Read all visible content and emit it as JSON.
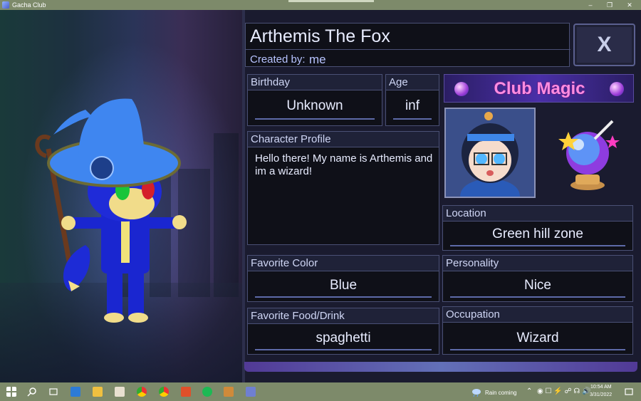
{
  "window": {
    "title": "Gacha Club"
  },
  "panel": {
    "character_name": "Arthemis The Fox",
    "created_by_label": "Created by:",
    "created_by_value": "me",
    "close_label": "X",
    "banner_text": "Club Magic",
    "birthday": {
      "label": "Birthday",
      "value": "Unknown"
    },
    "age": {
      "label": "Age",
      "value": "inf"
    },
    "profile": {
      "label": "Character Profile",
      "value": "Hello there! My name is Arthemis and im a wizard!"
    },
    "location": {
      "label": "Location",
      "value": "Green hill zone"
    },
    "favorite_color": {
      "label": "Favorite Color",
      "value": "Blue"
    },
    "personality": {
      "label": "Personality",
      "value": "Nice"
    },
    "favorite_food": {
      "label": "Favorite Food/Drink",
      "value": "spaghetti"
    },
    "occupation": {
      "label": "Occupation",
      "value": "Wizard"
    }
  },
  "taskbar": {
    "weather_text": "Rain coming",
    "time": "10:54 AM",
    "date": "3/31/2022"
  },
  "colors": {
    "panel_bg": "#1a1b2f",
    "box_bg": "#0f1018",
    "accent": "#5d6aa8",
    "taskbar": "#7d8a6a"
  }
}
